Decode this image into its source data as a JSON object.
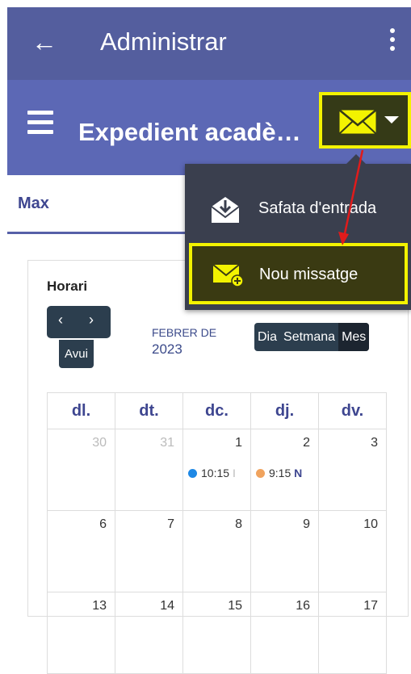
{
  "appbar": {
    "back_icon": "arrow-left-icon",
    "title": "Administrar",
    "more_icon": "more-vert-icon"
  },
  "subbar": {
    "menu_icon": "hamburger-icon",
    "title": "Expedient acadè…",
    "mail_icon": "envelope-icon",
    "dropdown_icon": "caret-down-icon"
  },
  "tab": {
    "label": "Max"
  },
  "dropdown": {
    "items": [
      {
        "label": "Safata d'entrada",
        "icon": "inbox-download-icon"
      },
      {
        "label": "Nou missatge",
        "icon": "envelope-plus-icon"
      }
    ]
  },
  "calendar": {
    "title": "Horari",
    "prev_label": "‹",
    "next_label": "›",
    "today_label": "Avui",
    "month": "FEBRER DE",
    "year": "2023",
    "views": [
      "Dia",
      "Setmana",
      "Mes"
    ],
    "active_view": "Mes",
    "weekdays": [
      "dl.",
      "dt.",
      "dc.",
      "dj.",
      "dv."
    ],
    "weeks": [
      [
        "30",
        "31",
        "1",
        "2",
        "3"
      ],
      [
        "6",
        "7",
        "8",
        "9",
        "10"
      ],
      [
        "13",
        "14",
        "15",
        "16",
        "17"
      ]
    ],
    "events": [
      {
        "time": "10:15",
        "text": "I",
        "color": "#1e88e5"
      },
      {
        "time": "9:15",
        "text": "N",
        "color": "#f0a35e"
      }
    ]
  },
  "colors": {
    "appbar": "#545e9e",
    "subbar": "#5c68b5",
    "highlight": "#f3f300",
    "annotation_arrow": "#e01b1b"
  }
}
